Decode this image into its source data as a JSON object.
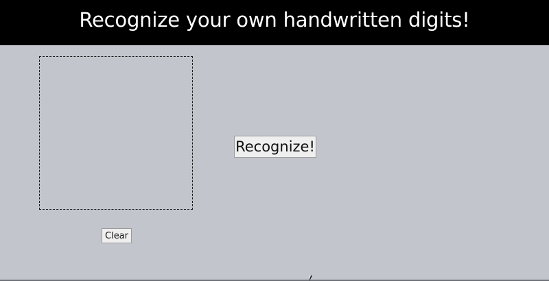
{
  "header": {
    "title": "Recognize your own handwritten digits!"
  },
  "controls": {
    "recognize_label": "Recognize!",
    "clear_label": "Clear"
  },
  "icons": {
    "pointer": "mouse-pointer-icon"
  },
  "colors": {
    "header_bg": "#000000",
    "header_text": "#ffffff",
    "page_bg": "#c2c5cc"
  }
}
